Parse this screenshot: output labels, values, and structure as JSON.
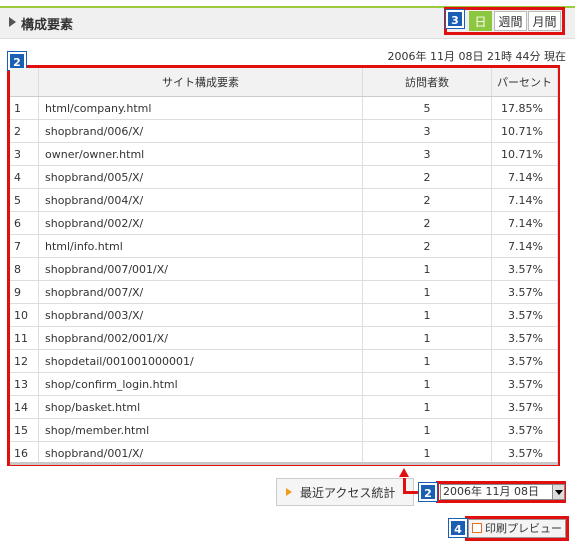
{
  "header": {
    "title": "構成要素"
  },
  "period_tabs": [
    {
      "label": "日",
      "active": true
    },
    {
      "label": "週間",
      "active": false
    },
    {
      "label": "月間",
      "active": false
    }
  ],
  "timestamp": "2006年 11月 08日 21時 44分 現在",
  "table": {
    "columns": [
      "",
      "サイト構成要素",
      "訪問者数",
      "パーセント"
    ],
    "rows": [
      [
        "1",
        "html/company.html",
        "5",
        "17.85%"
      ],
      [
        "2",
        "shopbrand/006/X/",
        "3",
        "10.71%"
      ],
      [
        "3",
        "owner/owner.html",
        "3",
        "10.71%"
      ],
      [
        "4",
        "shopbrand/005/X/",
        "2",
        "7.14%"
      ],
      [
        "5",
        "shopbrand/004/X/",
        "2",
        "7.14%"
      ],
      [
        "6",
        "shopbrand/002/X/",
        "2",
        "7.14%"
      ],
      [
        "7",
        "html/info.html",
        "2",
        "7.14%"
      ],
      [
        "8",
        "shopbrand/007/001/X/",
        "1",
        "3.57%"
      ],
      [
        "9",
        "shopbrand/007/X/",
        "1",
        "3.57%"
      ],
      [
        "10",
        "shopbrand/003/X/",
        "1",
        "3.57%"
      ],
      [
        "11",
        "shopbrand/002/001/X/",
        "1",
        "3.57%"
      ],
      [
        "12",
        "shopdetail/001001000001/",
        "1",
        "3.57%"
      ],
      [
        "13",
        "shop/confirm_login.html",
        "1",
        "3.57%"
      ],
      [
        "14",
        "shop/basket.html",
        "1",
        "3.57%"
      ],
      [
        "15",
        "shop/member.html",
        "1",
        "3.57%"
      ],
      [
        "16",
        "shopbrand/001/X/",
        "1",
        "3.57%"
      ]
    ]
  },
  "recent_stats": {
    "label": "最近アクセス統計"
  },
  "date_select": {
    "value": "2006年 11月 08日"
  },
  "print_preview": {
    "label": "印刷プレビュー"
  },
  "badges": {
    "table": "2",
    "tabs": "3",
    "date": "2",
    "print": "4"
  },
  "colors": {
    "accent": "#8dc63f",
    "highlight": "#e01010",
    "badge": "#1a5fb4"
  }
}
